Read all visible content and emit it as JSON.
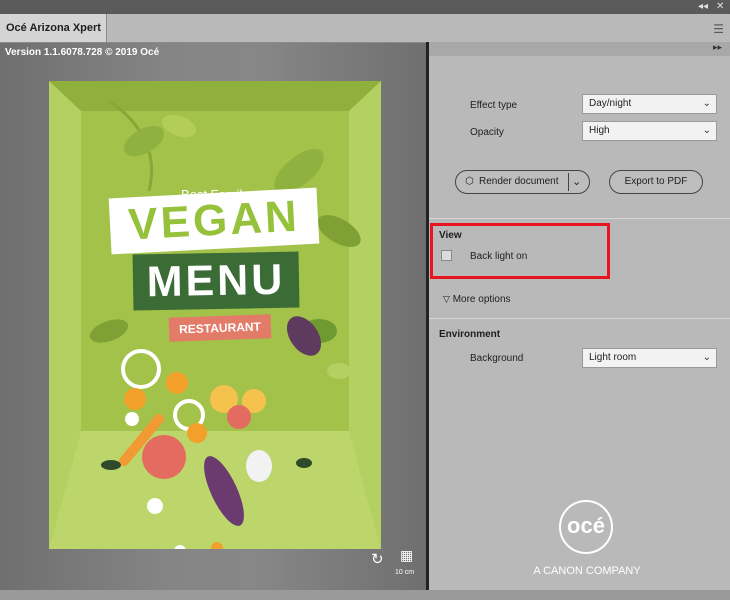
{
  "app": {
    "tab_title": "Océ Arizona Xpert",
    "version_text": "Version 1.1.6078.728 © 2019 Océ",
    "window_controls": [
      "◂◂",
      "✕"
    ],
    "menu_icon": "hamburger-icon"
  },
  "preview": {
    "poster": {
      "line1": "Best Family",
      "line2": "Restaurant",
      "word1": "VEGAN",
      "word2": "MENU",
      "word3": "RESTAURANT"
    },
    "tools": {
      "reset_icon": "reset-icon",
      "grid_icon": "grid-icon",
      "scale_label": "10 cm"
    }
  },
  "panel": {
    "collapse_icon": "double-chevron-right-icon",
    "effect_type": {
      "label": "Effect type",
      "value": "Day/night"
    },
    "opacity": {
      "label": "Opacity",
      "value": "High"
    },
    "render_button": "Render document",
    "export_button": "Export to PDF",
    "view": {
      "title": "View",
      "back_light_label": "Back light on",
      "back_light_checked": false
    },
    "more_options": "More options",
    "environment": {
      "title": "Environment",
      "background_label": "Background",
      "background_value": "Light room"
    },
    "logo_text": "océ",
    "tagline": "A CANON COMPANY"
  },
  "colors": {
    "highlight": "#e8141f",
    "poster_green": "#a3c249",
    "menu_green": "#3b6c35",
    "salmon": "#e37b69"
  }
}
